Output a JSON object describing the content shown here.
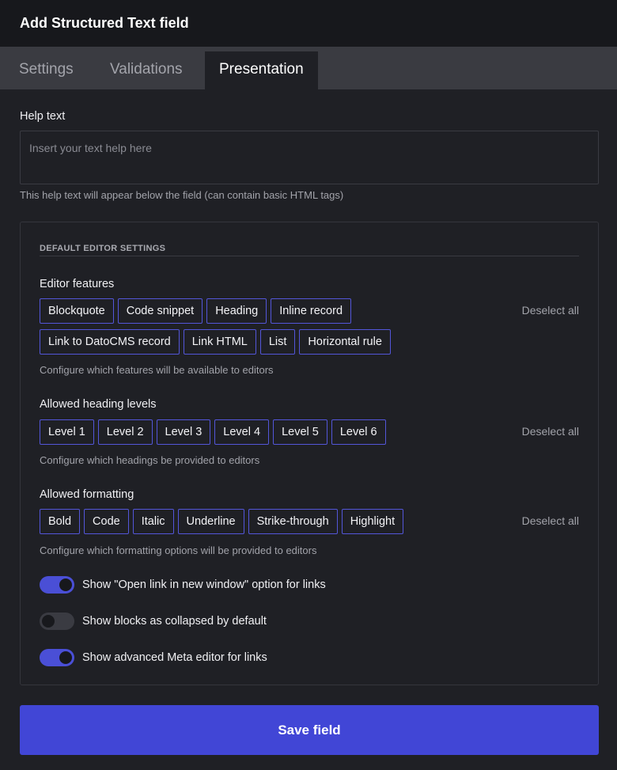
{
  "header": {
    "title": "Add Structured Text field"
  },
  "tabs": [
    {
      "label": "Settings"
    },
    {
      "label": "Validations"
    },
    {
      "label": "Presentation"
    }
  ],
  "help_text": {
    "label": "Help text",
    "placeholder": "Insert your text help here",
    "value": "",
    "hint": "This help text will appear below the field (can contain basic HTML tags)"
  },
  "panel": {
    "title": "DEFAULT EDITOR SETTINGS",
    "editor_features": {
      "label": "Editor features",
      "deselect": "Deselect all",
      "chips": [
        "Blockquote",
        "Code snippet",
        "Heading",
        "Inline record",
        "Link to DatoCMS record",
        "Link HTML",
        "List",
        "Horizontal rule"
      ],
      "hint": "Configure which features will be available to editors"
    },
    "heading_levels": {
      "label": "Allowed heading levels",
      "deselect": "Deselect all",
      "chips": [
        "Level 1",
        "Level 2",
        "Level 3",
        "Level 4",
        "Level 5",
        "Level 6"
      ],
      "hint": "Configure which headings be provided to editors"
    },
    "formatting": {
      "label": "Allowed formatting",
      "deselect": "Deselect all",
      "chips": [
        "Bold",
        "Code",
        "Italic",
        "Underline",
        "Strike-through",
        "Highlight"
      ],
      "hint": "Configure which formatting options will be provided to editors"
    },
    "toggles": [
      {
        "label": "Show \"Open link in new window\" option for links",
        "on": true
      },
      {
        "label": "Show blocks as collapsed by default",
        "on": false
      },
      {
        "label": "Show advanced Meta editor for links",
        "on": true
      }
    ]
  },
  "save_button": {
    "label": "Save field"
  },
  "colors": {
    "accent": "#4146d6",
    "chip_border": "#5356d9",
    "background": "#1f2025",
    "header": "#17181c",
    "tabbar": "#3a3b41"
  }
}
